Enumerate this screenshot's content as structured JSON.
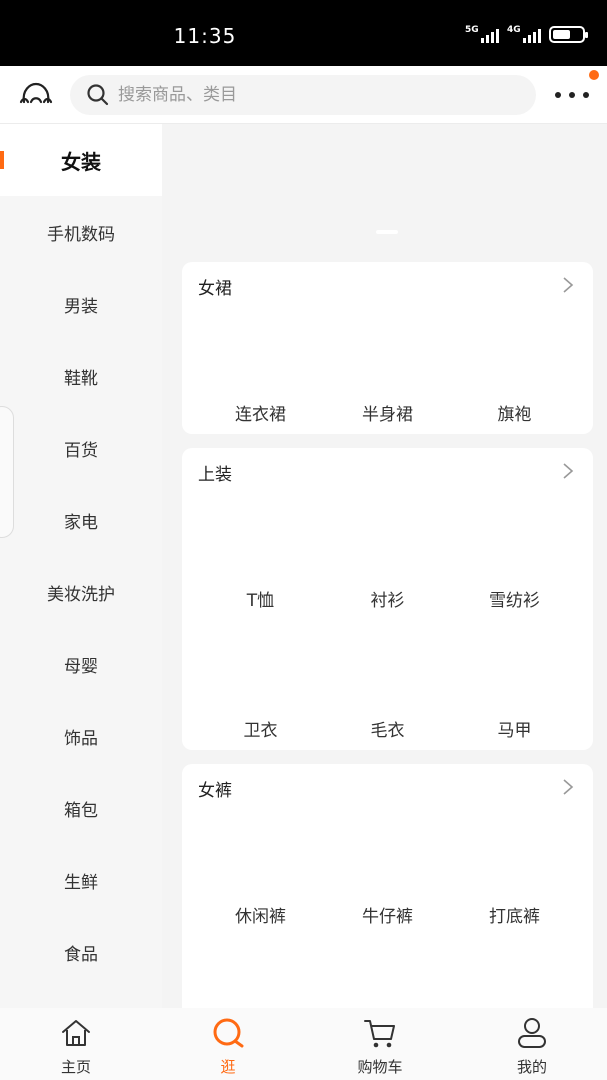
{
  "status": {
    "time": "11:35",
    "net1": "5G",
    "net2": "4G",
    "battery_fraction": 0.6
  },
  "header": {
    "search_placeholder": "搜索商品、类目"
  },
  "sidebar": {
    "active_index": 0,
    "items": [
      "女装",
      "手机数码",
      "男装",
      "鞋靴",
      "百货",
      "家电",
      "美妆洗护",
      "母婴",
      "饰品",
      "箱包",
      "生鲜",
      "食品"
    ]
  },
  "sections": [
    {
      "title": "女裙",
      "items": [
        "连衣裙",
        "半身裙",
        "旗袍"
      ]
    },
    {
      "title": "上装",
      "items": [
        "T恤",
        "衬衫",
        "雪纺衫",
        "卫衣",
        "毛衣",
        "马甲"
      ]
    },
    {
      "title": "女裤",
      "items": [
        "休闲裤",
        "牛仔裤",
        "打底裤"
      ]
    }
  ],
  "tabbar": {
    "active_index": 1,
    "tabs": [
      {
        "label": "主页",
        "icon": "home-icon"
      },
      {
        "label": "逛",
        "icon": "search-icon"
      },
      {
        "label": "购物车",
        "icon": "cart-icon"
      },
      {
        "label": "我的",
        "icon": "user-icon"
      }
    ]
  },
  "colors": {
    "accent": "#ff6a13"
  }
}
